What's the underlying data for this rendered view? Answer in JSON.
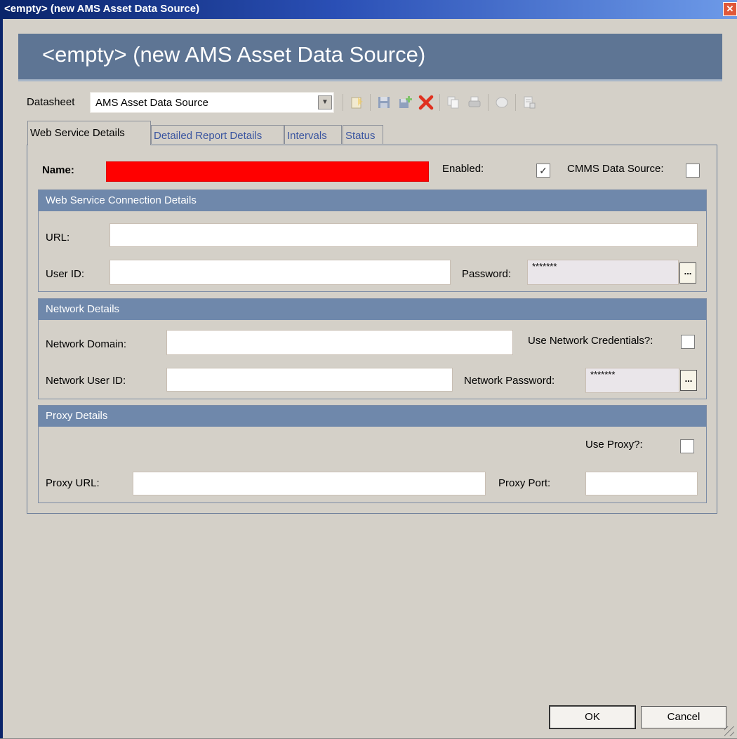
{
  "window": {
    "title": "<empty> (new AMS Asset Data Source)"
  },
  "banner": {
    "title": "<empty> (new AMS Asset Data Source)"
  },
  "toolbar": {
    "datasheet_label": "Datasheet",
    "datasheet_value": "AMS Asset Data Source",
    "icons": [
      "new-record-icon",
      "save-icon",
      "save-and-new-icon",
      "delete-icon",
      "copy-icon",
      "print-icon",
      "query-icon",
      "report-icon"
    ]
  },
  "tabs": [
    {
      "label": "Web Service Details"
    },
    {
      "label": "Detailed Report Details"
    },
    {
      "label": "Intervals"
    },
    {
      "label": "Status"
    }
  ],
  "form": {
    "name_label": "Name:",
    "name_value": "",
    "name_required_color": "#ff0000",
    "enabled_label": "Enabled:",
    "enabled_checked": true,
    "cmms_label": "CMMS Data Source:",
    "cmms_checked": false
  },
  "web_service": {
    "header": "Web Service Connection Details",
    "url_label": "URL:",
    "user_id_label": "User ID:",
    "password_label": "Password:",
    "password_value": "*******"
  },
  "network": {
    "header": "Network Details",
    "domain_label": "Network Domain:",
    "use_credentials_label": "Use Network Credentials?:",
    "use_credentials_checked": false,
    "user_id_label": "Network User ID:",
    "password_label": "Network Password:",
    "password_value": "*******"
  },
  "proxy": {
    "header": "Proxy Details",
    "use_proxy_label": "Use Proxy?:",
    "use_proxy_checked": false,
    "url_label": "Proxy URL:",
    "port_label": "Proxy Port:"
  },
  "buttons": {
    "ok": "OK",
    "cancel": "Cancel"
  },
  "colors": {
    "banner": "#5e7594",
    "group_header": "#6f88ab",
    "title_bar": "#0a246a"
  }
}
